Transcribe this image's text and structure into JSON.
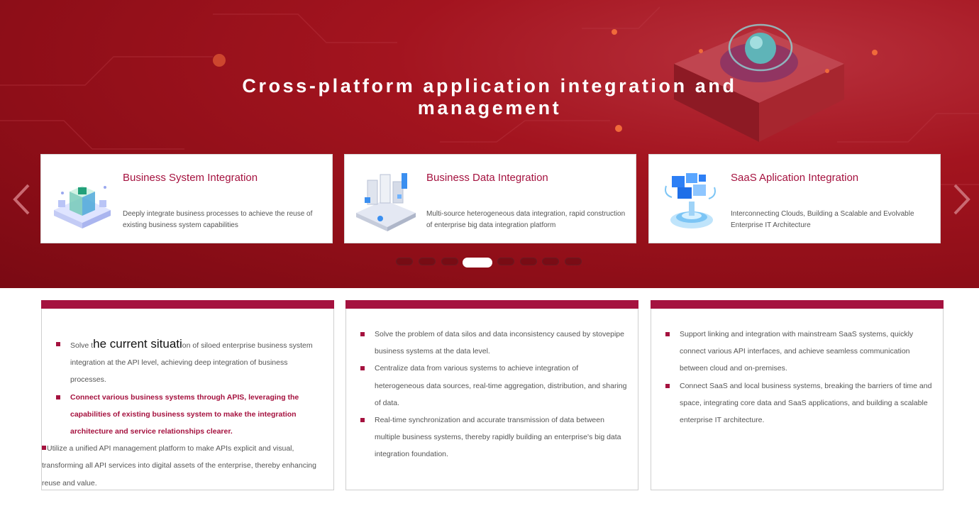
{
  "hero": {
    "title": "Cross-platform application integration and management",
    "prev_icon": "chevron-left-icon",
    "next_icon": "chevron-right-icon",
    "accent_color": "#a5123f",
    "background_color": "#9c111c"
  },
  "cards": [
    {
      "title": "Business System Integration",
      "description": "Deeply integrate business processes to achieve the reuse of existing business system capabilities",
      "icon": "cube-stack-icon"
    },
    {
      "title": "Business Data Integration",
      "description": "Multi-source heterogeneous data integration, rapid construction of enterprise big data integration platform",
      "icon": "data-blocks-icon"
    },
    {
      "title": "SaaS Aplication Integration",
      "description": "Interconnecting Clouds, Building a Scalable and Evolvable Enterprise IT Architecture",
      "icon": "cloud-platform-icon"
    }
  ],
  "pagination": {
    "total": 8,
    "active_index": 3
  },
  "panels": [
    {
      "first_prefix": "Solve t",
      "first_overlay": "he current situati",
      "first_suffix": "on of siloed enterprise business system integration at the API level, achieving deep integration of business processes.",
      "strong_item": "Connect various business systems through APIS, leveraging the capabilities of  existing business system to make the integration architecture and service relationships clearer.",
      "last_item": "Utilize a unified API management platform to make APIs explicit and visual, transforming all API services into digital assets of the enterprise, thereby enhancing reuse and value."
    },
    {
      "items": [
        "Solve the problem of data silos and data inconsistency caused by stovepipe business systems at the data level.",
        "Centralize data from various systems to achieve integration of heterogeneous data sources, real-time aggregation, distribution, and sharing of data.",
        "Real-time synchronization and accurate transmission of data between multiple business systems, thereby rapidly building an enterprise's big data integration foundation."
      ]
    },
    {
      "items": [
        "Support linking and integration with mainstream SaaS systems, quickly connect various API interfaces, and achieve seamless communication between cloud and on-premises.",
        "Connect SaaS and local business systems, breaking the barriers of time and space, integrating core data and SaaS applications, and building a scalable enterprise IT architecture."
      ]
    }
  ]
}
